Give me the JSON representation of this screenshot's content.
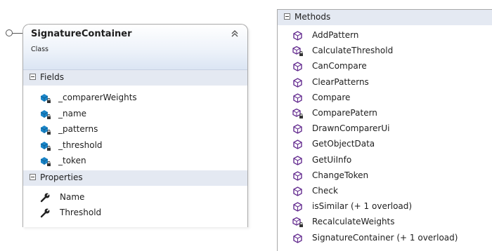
{
  "class": {
    "name": "SignatureContainer",
    "stereotype": "Class",
    "fields_section_label": "Fields",
    "properties_section_label": "Properties",
    "fields": [
      {
        "name": "_comparerWeights",
        "icon": "field-private-icon"
      },
      {
        "name": "_name",
        "icon": "field-private-icon"
      },
      {
        "name": "_patterns",
        "icon": "field-private-icon"
      },
      {
        "name": "_threshold",
        "icon": "field-private-icon"
      },
      {
        "name": "_token",
        "icon": "field-private-icon"
      }
    ],
    "properties": [
      {
        "name": "Name",
        "icon": "property-wrench-icon"
      },
      {
        "name": "Threshold",
        "icon": "property-wrench-icon"
      }
    ]
  },
  "methods_panel": {
    "section_label": "Methods",
    "methods": [
      {
        "name": "AddPattern",
        "icon": "method-public-icon"
      },
      {
        "name": "CalculateThreshold",
        "icon": "method-private-icon"
      },
      {
        "name": "CanCompare",
        "icon": "method-public-icon"
      },
      {
        "name": "ClearPatterns",
        "icon": "method-public-icon"
      },
      {
        "name": "Compare",
        "icon": "method-public-icon"
      },
      {
        "name": "ComparePatern",
        "icon": "method-private-icon"
      },
      {
        "name": "DrawnComparerUi",
        "icon": "method-public-icon"
      },
      {
        "name": "GetObjectData",
        "icon": "method-public-icon"
      },
      {
        "name": "GetUiInfo",
        "icon": "method-public-icon"
      },
      {
        "name": "ChangeToken",
        "icon": "method-public-icon"
      },
      {
        "name": "Check",
        "icon": "method-public-icon"
      },
      {
        "name": "isSimilar (+ 1 overload)",
        "icon": "method-public-icon"
      },
      {
        "name": "RecalculateWeights",
        "icon": "method-private-icon"
      },
      {
        "name": "SignatureContainer (+ 1 overload)",
        "icon": "method-public-icon"
      }
    ]
  },
  "colors": {
    "header_gradient_end": "#dbe5f3",
    "section_header_bg": "#e4e9f2",
    "border": "#a9a9a9",
    "field_icon_blue": "#1b86c9",
    "method_icon_purple": "#652d90"
  }
}
